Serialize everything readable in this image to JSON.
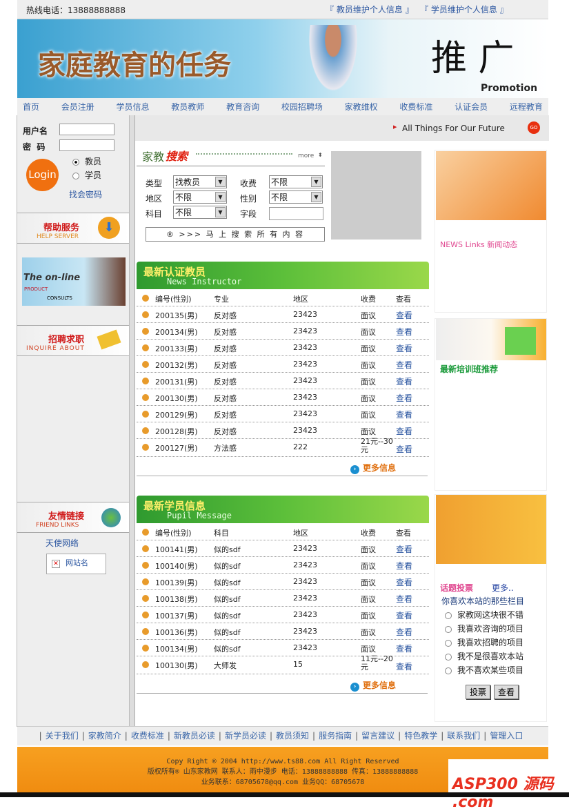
{
  "topbar": {
    "hotline": "热线电话：13888888888",
    "links": [
      "『 教员维护个人信息 』",
      "『 学员维护个人信息 』"
    ]
  },
  "banner": {
    "title": "家庭教育的任务",
    "promo_cn": "推 广",
    "promo_en": "Promotion"
  },
  "nav": [
    "首页",
    "会员注册",
    "学员信息",
    "教员教师",
    "教育咨询",
    "校园招聘场",
    "家教维权",
    "收费标准",
    "认证会员",
    "远程教育"
  ],
  "login": {
    "user_label": "用户名",
    "pass_label": "密  码",
    "button": "Login",
    "roles": [
      "教员",
      "学员"
    ],
    "forgot": "找会密码"
  },
  "left": {
    "help_cn": "帮助服务",
    "help_en": "HELP SERVER",
    "online1": "The on-line",
    "online2": "PRODUCT",
    "online3": "CONSULTS",
    "jobs_cn": "招聘求职",
    "jobs_en": "INQUIRE ABOUT",
    "friends_cn": "友情链接",
    "friends_en": "FRIEND LINKS",
    "friend_link": "天使网络",
    "site_name": "网站名"
  },
  "mainbar": {
    "slogan": "All Things For Our Future",
    "go": "GO"
  },
  "search": {
    "title1": "家教",
    "title2": "搜索",
    "more": "more",
    "labels": [
      "类型",
      "收费",
      "地区",
      "性别",
      "科目",
      "字段"
    ],
    "values": [
      "找教员",
      "不限",
      "不限",
      "不限",
      "不限"
    ],
    "button": "® >>> 马 上 搜 索 所 有 内 容"
  },
  "teachers": {
    "title": "最新认证教员",
    "subtitle": "News Instructor",
    "headers": [
      "编号(性别)",
      "专业",
      "地区",
      "收费",
      "查看"
    ],
    "rows": [
      [
        "200135(男)",
        "反对感",
        "23423",
        "面议",
        "查看"
      ],
      [
        "200134(男)",
        "反对感",
        "23423",
        "面议",
        "查看"
      ],
      [
        "200133(男)",
        "反对感",
        "23423",
        "面议",
        "查看"
      ],
      [
        "200132(男)",
        "反对感",
        "23423",
        "面议",
        "查看"
      ],
      [
        "200131(男)",
        "反对感",
        "23423",
        "面议",
        "查看"
      ],
      [
        "200130(男)",
        "反对感",
        "23423",
        "面议",
        "查看"
      ],
      [
        "200129(男)",
        "反对感",
        "23423",
        "面议",
        "查看"
      ],
      [
        "200128(男)",
        "反对感",
        "23423",
        "面议",
        "查看"
      ],
      [
        "200127(男)",
        "方法感",
        "222",
        "21元--30元",
        "查看"
      ]
    ],
    "more": "更多信息"
  },
  "students": {
    "title": "最新学员信息",
    "subtitle": "Pupil Message",
    "headers": [
      "编号(性别)",
      "科目",
      "地区",
      "收费",
      "查看"
    ],
    "rows": [
      [
        "100141(男)",
        "似的sdf",
        "23423",
        "面议",
        "查看"
      ],
      [
        "100140(男)",
        "似的sdf",
        "23423",
        "面议",
        "查看"
      ],
      [
        "100139(男)",
        "似的sdf",
        "23423",
        "面议",
        "查看"
      ],
      [
        "100138(男)",
        "似的sdf",
        "23423",
        "面议",
        "查看"
      ],
      [
        "100137(男)",
        "似的sdf",
        "23423",
        "面议",
        "查看"
      ],
      [
        "100136(男)",
        "似的sdf",
        "23423",
        "面议",
        "查看"
      ],
      [
        "100134(男)",
        "似的sdf",
        "23423",
        "面议",
        "查看"
      ],
      [
        "100130(男)",
        "大师发",
        "15",
        "11元--20元",
        "查看"
      ]
    ],
    "more": "更多信息"
  },
  "right": {
    "news": "NEWS Links 新闻动态",
    "training": "最新培训班推荐",
    "vote_title": "话题投票",
    "vote_more": "更多..",
    "question": "你喜欢本站的那些栏目",
    "options": [
      "家教网这块很不错",
      "我喜欢咨询的项目",
      "我喜欢招聘的项目",
      "我不是很喜欢本站",
      "我不喜欢某些项目"
    ],
    "vote_btn": "投票",
    "view_btn": "查看"
  },
  "footer": {
    "links": [
      "关于我们",
      "家教简介",
      "收费标准",
      "新教员必读",
      "新学员必读",
      "教员须知",
      "服务指南",
      "留言建议",
      "特色教学",
      "联系我们",
      "管理入口"
    ],
    "copy": "Copy Right ® 2004 http://www.ts88.com All Right Reserved",
    "owner": "版权所有® 山东家教网 联系人：雨中漫步 电话：13888888888 传真：13888888888",
    "biz": "业务联系：68705678@qq.com  业务QQ：68705678",
    "logo": "ASP300 源码 .com"
  }
}
